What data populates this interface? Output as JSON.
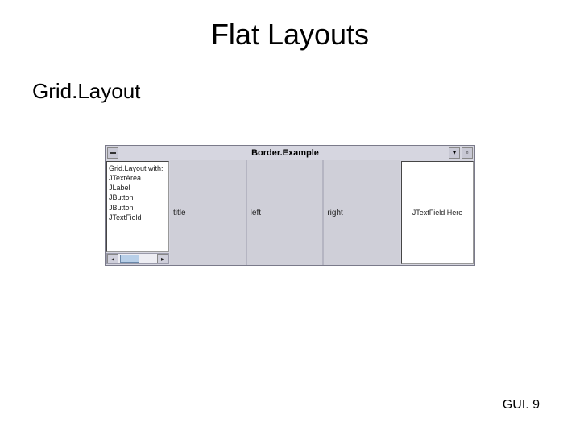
{
  "title": "Flat Layouts",
  "subtitle": "Grid.Layout",
  "window": {
    "title": "Border.Example",
    "west": {
      "lines": [
        "Grid.Layout with:",
        "JTextArea",
        "JLabel",
        "JButton",
        "JButton",
        "JTextField"
      ]
    },
    "center": {
      "cols": [
        "title",
        "left",
        "right"
      ]
    },
    "east": {
      "text": "JTextField Here"
    }
  },
  "footer": "GUI. 9"
}
